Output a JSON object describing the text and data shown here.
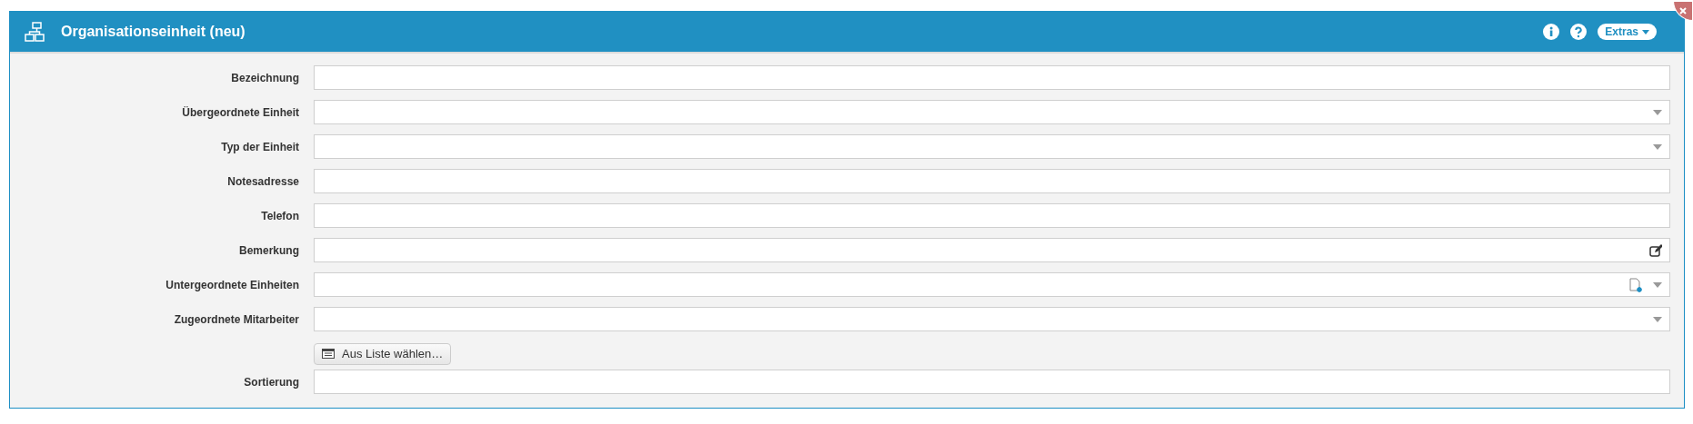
{
  "window": {
    "title": "Organisationseinheit (neu)",
    "extras_label": "Extras"
  },
  "fields": [
    {
      "label": "Bezeichnung",
      "kind": "text"
    },
    {
      "label": "Übergeordnete Einheit",
      "kind": "select"
    },
    {
      "label": "Typ der Einheit",
      "kind": "select"
    },
    {
      "label": "Notesadresse",
      "kind": "text"
    },
    {
      "label": "Telefon",
      "kind": "text"
    },
    {
      "label": "Bemerkung",
      "kind": "memo"
    },
    {
      "label": "Untergeordnete Einheiten",
      "kind": "select-new"
    },
    {
      "label": "Zugeordnete Mitarbeiter",
      "kind": "select"
    },
    {
      "label": "Aus Liste wählen…",
      "kind": "button"
    },
    {
      "label": "Sortierung",
      "kind": "text"
    }
  ]
}
